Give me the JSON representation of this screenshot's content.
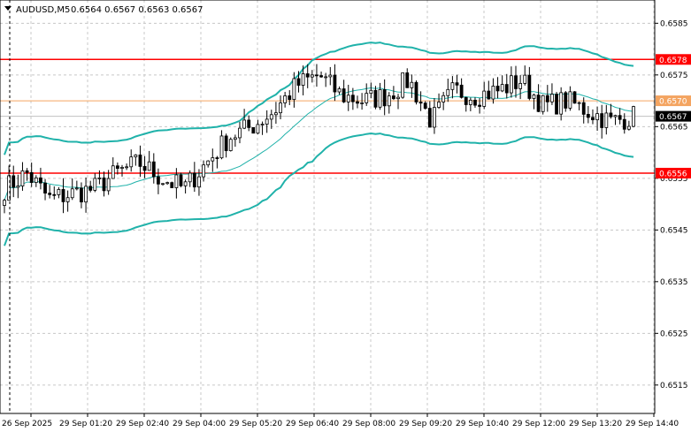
{
  "header": {
    "symbol": "AUDUSD,M5",
    "ohlc": "0.6564 0.6567 0.6563 0.6567",
    "menu_icon": "triangle-down-icon"
  },
  "chart_data": {
    "type": "candlestick",
    "symbol": "AUDUSD",
    "timeframe": "M5",
    "ylim": [
      0.65095,
      0.65895
    ],
    "y_ticks": [
      "0.6585",
      "0.6575",
      "0.6565",
      "0.6555",
      "0.6545",
      "0.6535",
      "0.6525",
      "0.6515"
    ],
    "x_ticks": [
      "26 Sep 2025",
      "29 Sep 01:20",
      "29 Sep 02:40",
      "29 Sep 04:00",
      "29 Sep 05:20",
      "29 Sep 06:40",
      "29 Sep 08:00",
      "29 Sep 09:20",
      "29 Sep 10:40",
      "29 Sep 12:00",
      "29 Sep 13:20",
      "29 Sep 14:40"
    ],
    "levels": [
      {
        "value": 0.6578,
        "label": "0.6578",
        "color": "#ff0000"
      },
      {
        "value": 0.657,
        "label": "0.6570",
        "color": "#f4a460"
      },
      {
        "value": 0.6556,
        "label": "0.6556",
        "color": "#ff0000"
      }
    ],
    "current_price": {
      "value": 0.6567,
      "label": "0.6567"
    },
    "close_anchors": [
      0.6553,
      0.6556,
      0.6551,
      0.6552,
      0.6553,
      0.6556,
      0.6558,
      0.6555,
      0.6553,
      0.6558,
      0.6563,
      0.6565,
      0.6568,
      0.6573,
      0.6575,
      0.6571,
      0.657,
      0.6571,
      0.6574,
      0.6566,
      0.6572,
      0.6571,
      0.6572,
      0.6574,
      0.6569,
      0.657,
      0.6568,
      0.6566,
      0.6567
    ],
    "bands_color": "#20b2aa",
    "ma_color": "#20b2aa",
    "candle_color": "#000000"
  }
}
